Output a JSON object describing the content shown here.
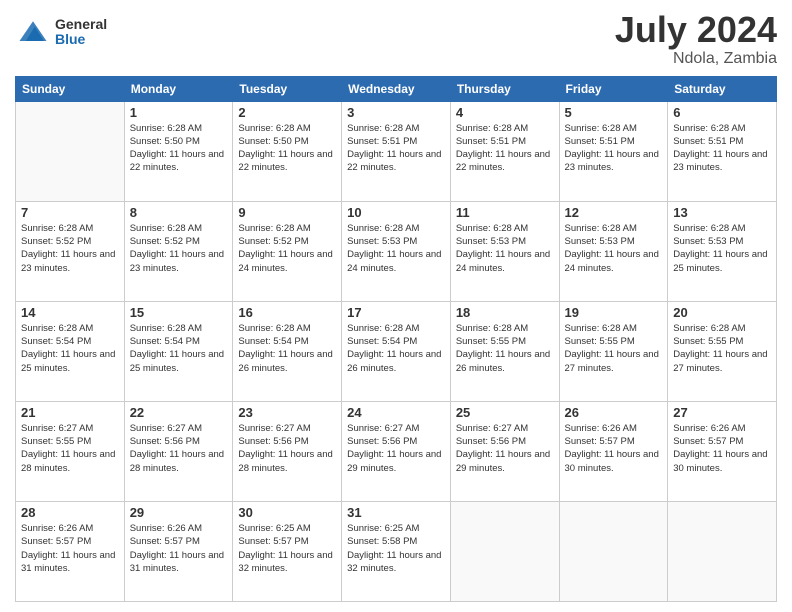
{
  "logo": {
    "general": "General",
    "blue": "Blue"
  },
  "title": "July 2024",
  "location": "Ndola, Zambia",
  "weekdays": [
    "Sunday",
    "Monday",
    "Tuesday",
    "Wednesday",
    "Thursday",
    "Friday",
    "Saturday"
  ],
  "weeks": [
    [
      {
        "day": "",
        "sunrise": "",
        "sunset": "",
        "daylight": ""
      },
      {
        "day": "1",
        "sunrise": "Sunrise: 6:28 AM",
        "sunset": "Sunset: 5:50 PM",
        "daylight": "Daylight: 11 hours and 22 minutes."
      },
      {
        "day": "2",
        "sunrise": "Sunrise: 6:28 AM",
        "sunset": "Sunset: 5:50 PM",
        "daylight": "Daylight: 11 hours and 22 minutes."
      },
      {
        "day": "3",
        "sunrise": "Sunrise: 6:28 AM",
        "sunset": "Sunset: 5:51 PM",
        "daylight": "Daylight: 11 hours and 22 minutes."
      },
      {
        "day": "4",
        "sunrise": "Sunrise: 6:28 AM",
        "sunset": "Sunset: 5:51 PM",
        "daylight": "Daylight: 11 hours and 22 minutes."
      },
      {
        "day": "5",
        "sunrise": "Sunrise: 6:28 AM",
        "sunset": "Sunset: 5:51 PM",
        "daylight": "Daylight: 11 hours and 23 minutes."
      },
      {
        "day": "6",
        "sunrise": "Sunrise: 6:28 AM",
        "sunset": "Sunset: 5:51 PM",
        "daylight": "Daylight: 11 hours and 23 minutes."
      }
    ],
    [
      {
        "day": "7",
        "sunrise": "Sunrise: 6:28 AM",
        "sunset": "Sunset: 5:52 PM",
        "daylight": "Daylight: 11 hours and 23 minutes."
      },
      {
        "day": "8",
        "sunrise": "Sunrise: 6:28 AM",
        "sunset": "Sunset: 5:52 PM",
        "daylight": "Daylight: 11 hours and 23 minutes."
      },
      {
        "day": "9",
        "sunrise": "Sunrise: 6:28 AM",
        "sunset": "Sunset: 5:52 PM",
        "daylight": "Daylight: 11 hours and 24 minutes."
      },
      {
        "day": "10",
        "sunrise": "Sunrise: 6:28 AM",
        "sunset": "Sunset: 5:53 PM",
        "daylight": "Daylight: 11 hours and 24 minutes."
      },
      {
        "day": "11",
        "sunrise": "Sunrise: 6:28 AM",
        "sunset": "Sunset: 5:53 PM",
        "daylight": "Daylight: 11 hours and 24 minutes."
      },
      {
        "day": "12",
        "sunrise": "Sunrise: 6:28 AM",
        "sunset": "Sunset: 5:53 PM",
        "daylight": "Daylight: 11 hours and 24 minutes."
      },
      {
        "day": "13",
        "sunrise": "Sunrise: 6:28 AM",
        "sunset": "Sunset: 5:53 PM",
        "daylight": "Daylight: 11 hours and 25 minutes."
      }
    ],
    [
      {
        "day": "14",
        "sunrise": "Sunrise: 6:28 AM",
        "sunset": "Sunset: 5:54 PM",
        "daylight": "Daylight: 11 hours and 25 minutes."
      },
      {
        "day": "15",
        "sunrise": "Sunrise: 6:28 AM",
        "sunset": "Sunset: 5:54 PM",
        "daylight": "Daylight: 11 hours and 25 minutes."
      },
      {
        "day": "16",
        "sunrise": "Sunrise: 6:28 AM",
        "sunset": "Sunset: 5:54 PM",
        "daylight": "Daylight: 11 hours and 26 minutes."
      },
      {
        "day": "17",
        "sunrise": "Sunrise: 6:28 AM",
        "sunset": "Sunset: 5:54 PM",
        "daylight": "Daylight: 11 hours and 26 minutes."
      },
      {
        "day": "18",
        "sunrise": "Sunrise: 6:28 AM",
        "sunset": "Sunset: 5:55 PM",
        "daylight": "Daylight: 11 hours and 26 minutes."
      },
      {
        "day": "19",
        "sunrise": "Sunrise: 6:28 AM",
        "sunset": "Sunset: 5:55 PM",
        "daylight": "Daylight: 11 hours and 27 minutes."
      },
      {
        "day": "20",
        "sunrise": "Sunrise: 6:28 AM",
        "sunset": "Sunset: 5:55 PM",
        "daylight": "Daylight: 11 hours and 27 minutes."
      }
    ],
    [
      {
        "day": "21",
        "sunrise": "Sunrise: 6:27 AM",
        "sunset": "Sunset: 5:55 PM",
        "daylight": "Daylight: 11 hours and 28 minutes."
      },
      {
        "day": "22",
        "sunrise": "Sunrise: 6:27 AM",
        "sunset": "Sunset: 5:56 PM",
        "daylight": "Daylight: 11 hours and 28 minutes."
      },
      {
        "day": "23",
        "sunrise": "Sunrise: 6:27 AM",
        "sunset": "Sunset: 5:56 PM",
        "daylight": "Daylight: 11 hours and 28 minutes."
      },
      {
        "day": "24",
        "sunrise": "Sunrise: 6:27 AM",
        "sunset": "Sunset: 5:56 PM",
        "daylight": "Daylight: 11 hours and 29 minutes."
      },
      {
        "day": "25",
        "sunrise": "Sunrise: 6:27 AM",
        "sunset": "Sunset: 5:56 PM",
        "daylight": "Daylight: 11 hours and 29 minutes."
      },
      {
        "day": "26",
        "sunrise": "Sunrise: 6:26 AM",
        "sunset": "Sunset: 5:57 PM",
        "daylight": "Daylight: 11 hours and 30 minutes."
      },
      {
        "day": "27",
        "sunrise": "Sunrise: 6:26 AM",
        "sunset": "Sunset: 5:57 PM",
        "daylight": "Daylight: 11 hours and 30 minutes."
      }
    ],
    [
      {
        "day": "28",
        "sunrise": "Sunrise: 6:26 AM",
        "sunset": "Sunset: 5:57 PM",
        "daylight": "Daylight: 11 hours and 31 minutes."
      },
      {
        "day": "29",
        "sunrise": "Sunrise: 6:26 AM",
        "sunset": "Sunset: 5:57 PM",
        "daylight": "Daylight: 11 hours and 31 minutes."
      },
      {
        "day": "30",
        "sunrise": "Sunrise: 6:25 AM",
        "sunset": "Sunset: 5:57 PM",
        "daylight": "Daylight: 11 hours and 32 minutes."
      },
      {
        "day": "31",
        "sunrise": "Sunrise: 6:25 AM",
        "sunset": "Sunset: 5:58 PM",
        "daylight": "Daylight: 11 hours and 32 minutes."
      },
      {
        "day": "",
        "sunrise": "",
        "sunset": "",
        "daylight": ""
      },
      {
        "day": "",
        "sunrise": "",
        "sunset": "",
        "daylight": ""
      },
      {
        "day": "",
        "sunrise": "",
        "sunset": "",
        "daylight": ""
      }
    ]
  ]
}
